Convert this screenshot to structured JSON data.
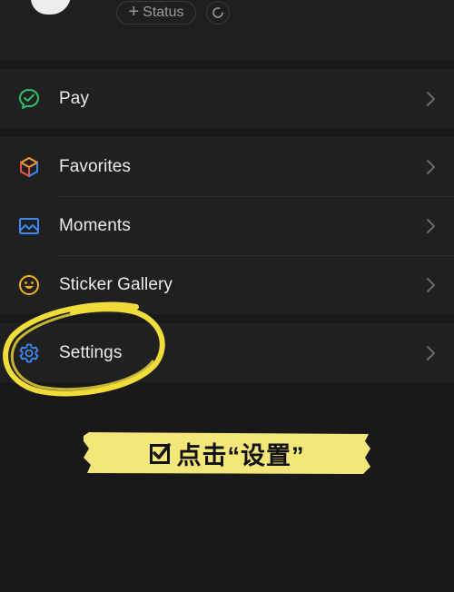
{
  "header": {
    "status_label": "Status",
    "status_plus": "+"
  },
  "groups": [
    {
      "items": [
        {
          "label": "Pay",
          "icon": "pay-icon",
          "color": "#2ec26a"
        }
      ]
    },
    {
      "items": [
        {
          "label": "Favorites",
          "icon": "cube-icon"
        },
        {
          "label": "Moments",
          "icon": "image-icon",
          "color": "#3d8bf0"
        },
        {
          "label": "Sticker Gallery",
          "icon": "smiley-icon",
          "color": "#f2b51e"
        }
      ]
    },
    {
      "items": [
        {
          "label": "Settings",
          "icon": "gear-icon",
          "color": "#3d8bf0"
        }
      ]
    }
  ],
  "annotation": {
    "text": "点击“设置”",
    "highlight_color": "#f3e77a",
    "circle_color": "#f0dc3a"
  }
}
